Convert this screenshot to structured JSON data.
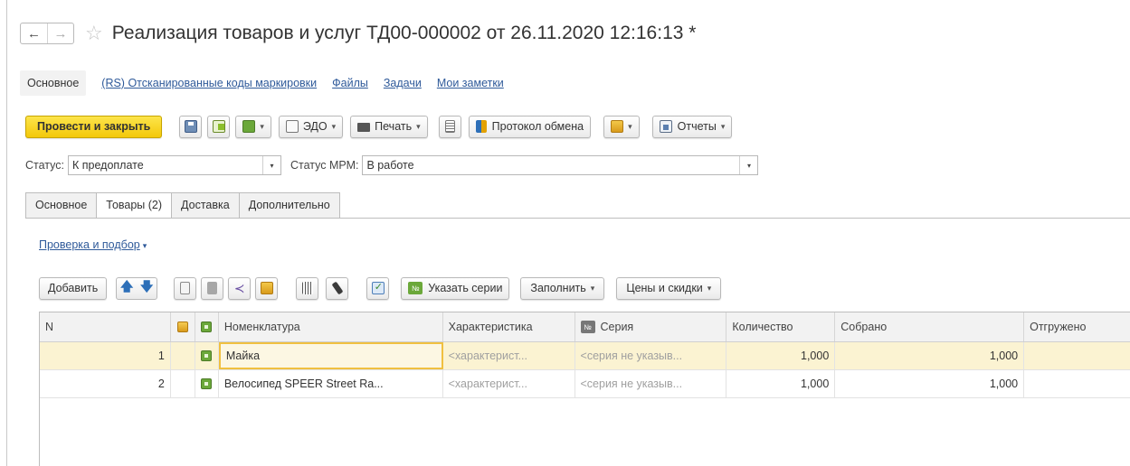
{
  "window": {
    "title": "Реализация товаров и услуг ТД00-000002 от 26.11.2020 12:16:13 *"
  },
  "colors": {
    "primary": "#f3c80a",
    "link": "#2f5a9a",
    "selected_row": "#fbf3d2"
  },
  "icons": {
    "back": "←",
    "forward": "→",
    "star": "☆",
    "caret": "▾",
    "up_arrow": "🡅",
    "down_arrow": "🡇",
    "share": "≺",
    "number_badge": "№"
  },
  "toplinks": {
    "main": "Основное",
    "items": [
      "(RS) Отсканированные коды маркировки",
      "Файлы",
      "Задачи",
      "Мои заметки"
    ]
  },
  "toolbar": {
    "post_close": "Провести и закрыть",
    "edo": "ЭДО",
    "print": "Печать",
    "exchange_protocol": "Протокол обмена",
    "reports": "Отчеты"
  },
  "status": {
    "label": "Статус:",
    "value": "К предоплате",
    "mrm_label": "Статус МРМ:",
    "mrm_value": "В работе"
  },
  "tabs": [
    "Основное",
    "Товары (2)",
    "Доставка",
    "Дополнительно"
  ],
  "check_link": "Проверка и подбор",
  "table_toolbar": {
    "add": "Добавить",
    "set_series": "Указать серии",
    "fill": "Заполнить",
    "prices": "Цены и скидки"
  },
  "grid": {
    "columns": [
      "N",
      "Номенклатура",
      "Характеристика",
      "Серия",
      "Количество",
      "Собрано",
      "Отгружено"
    ],
    "rows": [
      {
        "n": "1",
        "name": "Майка",
        "char": "<характерист...",
        "series": "<серия не указыв...",
        "qty": "1,000",
        "collected": "1,000",
        "shipped": ""
      },
      {
        "n": "2",
        "name": "Велосипед SPEER Street Ra...",
        "char": "<характерист...",
        "series": "<серия не указыв...",
        "qty": "1,000",
        "collected": "1,000",
        "shipped": ""
      }
    ]
  }
}
